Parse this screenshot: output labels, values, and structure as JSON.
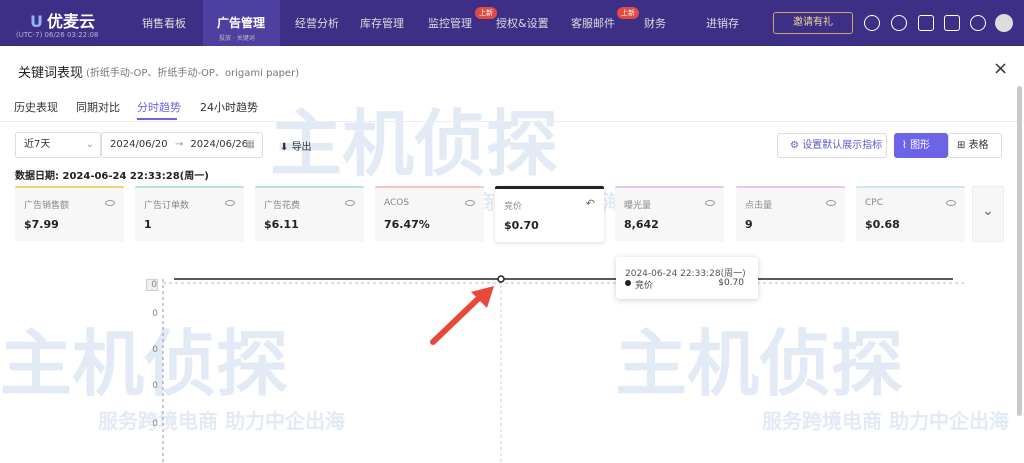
{
  "nav": {
    "brand": "优麦云",
    "timezone": "(UTC-7) 06/26 03:22:08",
    "items": [
      "销售看板",
      "经营分析",
      "库存管理",
      "监控管理",
      "授权&设置",
      "客服邮件",
      "财务",
      "进销存"
    ],
    "active": {
      "label": "广告管理",
      "sub": "投放 · 关键词"
    },
    "new_badge": "上新",
    "invite": "邀请有礼"
  },
  "dialog": {
    "title": "关键词表现",
    "subtitle": "(折纸手动-OP、折纸手动-OP、origami paper)",
    "close_icon": "×",
    "tabs": [
      "历史表现",
      "同期对比",
      "分时趋势",
      "24小时趋势"
    ],
    "active_tab": 2
  },
  "controls": {
    "range": "近7天",
    "date_start": "2024/06/20",
    "date_arrow": "→",
    "date_end": "2024/06/26",
    "export": "导出",
    "setting": "设置默认展示指标",
    "graph": "图形",
    "table": "表格"
  },
  "data_date": {
    "label": "数据日期:",
    "value": "2024-06-24 22:33:28(周一)"
  },
  "metrics": [
    {
      "label": "广告销售额",
      "value": "$7.99",
      "color": "#f2d06b"
    },
    {
      "label": "广告订单数",
      "value": "1",
      "color": "#b6e5d0"
    },
    {
      "label": "广告花费",
      "value": "$6.11",
      "color": "#b6e5d0"
    },
    {
      "label": "ACOS",
      "value": "76.47%",
      "color": "#f6c7c0"
    },
    {
      "label": "竞价",
      "value": "$0.70",
      "color": "#222222"
    },
    {
      "label": "曝光量",
      "value": "8,642",
      "color": "#e5c7f2"
    },
    {
      "label": "点击量",
      "value": "9",
      "color": "#e5c7f2"
    },
    {
      "label": "CPC",
      "value": "$0.68",
      "color": "#c8e8f2"
    }
  ],
  "chart_data": {
    "type": "line",
    "series": [
      {
        "name": "竞价",
        "values": [
          0.7
        ]
      }
    ],
    "y_ticks": [
      "0",
      "0",
      "0",
      "0",
      "0"
    ],
    "tooltip": {
      "time": "2024-06-24 22:33:28(周一)",
      "name": "竞价",
      "value": "$0.70"
    }
  },
  "watermark": {
    "brand": "主机侦探",
    "slogan": "服务跨境电商 助力中企出海"
  }
}
